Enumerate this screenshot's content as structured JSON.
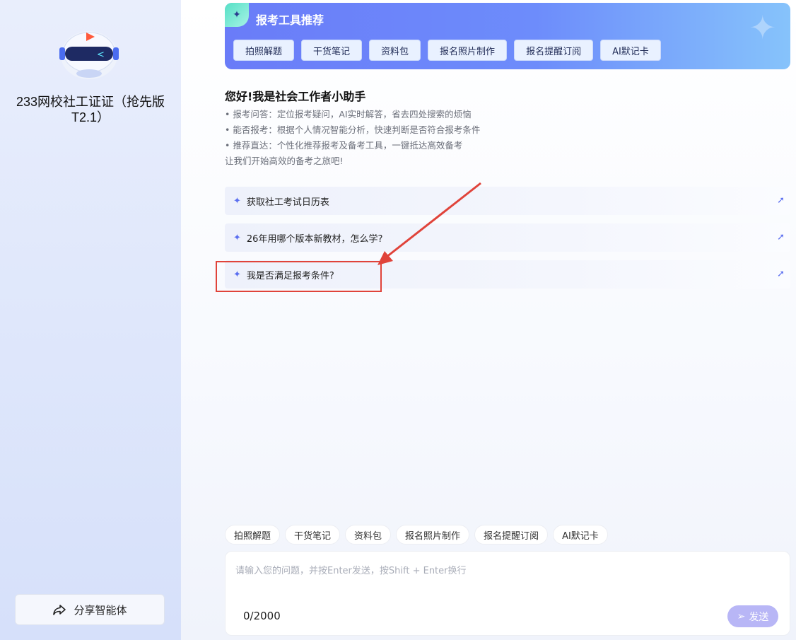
{
  "sidebar": {
    "agent_name": "233网校社工证证（抢先版T2.1）",
    "share_label": "分享智能体"
  },
  "banner": {
    "title": "报考工具推荐",
    "tools": [
      "拍照解题",
      "干货笔记",
      "资料包",
      "报名照片制作",
      "报名提醒订阅",
      "AI默记卡"
    ]
  },
  "greeting": {
    "title": "您好!我是社会工作者小助手",
    "lines": [
      "• 报考问答：定位报考疑问，AI实时解答，省去四处搜索的烦恼",
      "• 能否报考：根据个人情况智能分析，快速判断是否符合报考条件",
      "• 推荐直达：个性化推荐报考及备考工具，一键抵达高效备考",
      "让我们开始高效的备考之旅吧!"
    ]
  },
  "suggestions": [
    "获取社工考试日历表",
    "26年用哪个版本新教材，怎么学?",
    "我是否满足报考条件?"
  ],
  "quick_tools": [
    "拍照解题",
    "干货笔记",
    "资料包",
    "报名照片制作",
    "报名提醒订阅",
    "AI默记卡"
  ],
  "input": {
    "placeholder": "请输入您的问题，并按Enter发送，按Shift + Enter换行",
    "counter": "0/2000",
    "send_label": "发送"
  },
  "colors": {
    "accent": "#6a7cf8",
    "highlight_box": "#e0433a",
    "send_button": "#b8b6f6"
  }
}
